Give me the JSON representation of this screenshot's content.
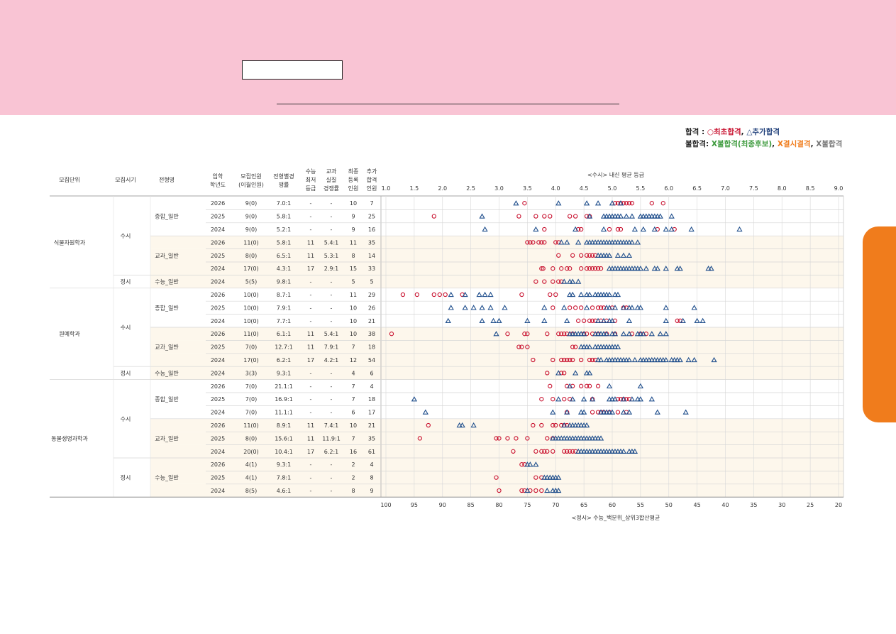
{
  "legend": {
    "pass_label": "합격",
    "pass_sep": " : ",
    "first_pass": "○최초합격",
    "comma": ", ",
    "add_pass": "△추가합격",
    "fail_label": "불합격",
    "fail_sep": ": ",
    "fail_waitlist": "X불합격(최종후보)",
    "fail_absent": "X결시결격",
    "fail_plain": "X불합격"
  },
  "colors": {
    "first": "#c8102e",
    "additional": "#1f4e8c",
    "grid": "#dddddd",
    "band": "#fdf7ec"
  },
  "headers": {
    "unit": "모집단위",
    "period": "모집시기",
    "type": "전형명",
    "year": [
      "입학",
      "학년도"
    ],
    "quota": [
      "모집인원",
      "(이월인원)"
    ],
    "ratio": [
      "전형별경",
      "쟁률"
    ],
    "min": [
      "수능",
      "최저",
      "등급"
    ],
    "actual": [
      "교과",
      "실질",
      "경쟁률"
    ],
    "reg": [
      "최종",
      "등록",
      "인원"
    ],
    "extra": [
      "추가",
      "합격",
      "인원"
    ]
  },
  "chart_data": {
    "type": "scatter",
    "title": "<수시> 내신 평균 등급",
    "xlabel": "<정시> 수능_백분위_상위3합산평균",
    "x_top_ticks": [
      "1.0",
      "1.5",
      "2.0",
      "2.5",
      "3.0",
      "3.5",
      "4.0",
      "4.5",
      "5.0",
      "5.5",
      "6.0",
      "6.5",
      "7.0",
      "7.5",
      "8.0",
      "8.5",
      "9.0"
    ],
    "x_top_range": [
      1.0,
      9.0
    ],
    "x_bottom_ticks": [
      "100",
      "95",
      "90",
      "85",
      "80",
      "75",
      "70",
      "65",
      "60",
      "55",
      "50",
      "45",
      "40",
      "35",
      "30",
      "25",
      "20"
    ],
    "x_bottom_range": [
      100,
      20
    ],
    "legend": [
      "○ 최초합격",
      "△ 추가합격"
    ],
    "grid": true
  },
  "groups": [
    {
      "unit": "식물자원학과",
      "rows": [
        {
          "period": "수시",
          "type": "종합_일반",
          "year": "2026",
          "quota": "9(0)",
          "ratio": "7.0:1",
          "min": "-",
          "actual": "-",
          "reg": "10",
          "extra": "7",
          "first": [
            3.45,
            5.05,
            5.1,
            5.15,
            5.2,
            5.25,
            5.3,
            5.35,
            5.7,
            5.9
          ],
          "additional": [
            3.3,
            4.05,
            4.55,
            4.75,
            5.0,
            5.15
          ]
        },
        {
          "period": "수시",
          "type": "종합_일반",
          "year": "2025",
          "quota": "9(0)",
          "ratio": "5.8:1",
          "min": "-",
          "actual": "-",
          "reg": "9",
          "extra": "25",
          "first": [
            1.85,
            3.35,
            3.65,
            3.8,
            3.9,
            4.25,
            4.35,
            4.55,
            4.6
          ],
          "additional": [
            2.7,
            4.6,
            4.85,
            4.9,
            4.95,
            5.0,
            5.05,
            5.1,
            5.15,
            5.25,
            5.35,
            5.5,
            5.55,
            5.6,
            5.65,
            5.7,
            5.75,
            5.8,
            5.85,
            6.05
          ]
        },
        {
          "period": "수시",
          "type": "종합_일반",
          "year": "2024",
          "quota": "9(0)",
          "ratio": "5.2:1",
          "min": "-",
          "actual": "-",
          "reg": "9",
          "extra": "16",
          "first": [
            3.8,
            4.4,
            4.45,
            4.95,
            5.1,
            5.15,
            5.8,
            6.1
          ],
          "additional": [
            2.75,
            3.65,
            4.35,
            4.85,
            5.4,
            5.55,
            5.75,
            5.95,
            6.05,
            6.4,
            7.25
          ]
        },
        {
          "period": "수시",
          "type": "교과_일반",
          "year": "2026",
          "quota": "11(0)",
          "ratio": "5.8:1",
          "min": "11",
          "actual": "5.4:1",
          "reg": "11",
          "expanded": "35",
          "extra": "35",
          "first": [
            3.5,
            3.55,
            3.6,
            3.7,
            3.75,
            3.8,
            4.0,
            4.05
          ],
          "additional": [
            4.1,
            4.2,
            4.4,
            4.55,
            4.6,
            4.65,
            4.7,
            4.75,
            4.8,
            4.85,
            4.9,
            4.95,
            5.0,
            5.05,
            5.1,
            5.15,
            5.2,
            5.25,
            5.3,
            5.35,
            5.45
          ]
        },
        {
          "period": "수시",
          "type": "교과_일반",
          "year": "2025",
          "quota": "8(0)",
          "ratio": "6.5:1",
          "min": "11",
          "actual": "5.3:1",
          "reg": "8",
          "extra": "14",
          "first": [
            4.05,
            4.3,
            4.45,
            4.55,
            4.6,
            4.65,
            4.7
          ],
          "additional": [
            4.75,
            4.8,
            4.85,
            4.9,
            4.95,
            5.1,
            5.2,
            5.3
          ]
        },
        {
          "period": "수시",
          "type": "교과_일반",
          "year": "2024",
          "quota": "17(0)",
          "ratio": "4.3:1",
          "min": "17",
          "actual": "2.9:1",
          "reg": "15",
          "extra": "33",
          "first": [
            3.75,
            3.78,
            3.95,
            4.1,
            4.2,
            4.25,
            4.45,
            4.55,
            4.6,
            4.65,
            4.7,
            4.75,
            4.8
          ],
          "additional": [
            4.95,
            5.0,
            5.05,
            5.1,
            5.15,
            5.2,
            5.25,
            5.3,
            5.35,
            5.4,
            5.45,
            5.5,
            5.6,
            5.75,
            5.8,
            5.95,
            6.15,
            6.2,
            6.7,
            6.75
          ]
        },
        {
          "period": "정시",
          "type": "수능_일반",
          "year": "2024",
          "quota": "5(5)",
          "ratio": "9.8:1",
          "min": "-",
          "actual": "-",
          "reg": "5",
          "extra": "5",
          "first": [
            3.65,
            3.8,
            3.95,
            4.05,
            4.1
          ],
          "additional": [
            4.15,
            4.25,
            4.3,
            4.4
          ]
        }
      ]
    },
    {
      "unit": "원예학과",
      "rows": [
        {
          "period": "수시",
          "type": "종합_일반",
          "year": "2026",
          "quota": "10(0)",
          "ratio": "8.7:1",
          "min": "-",
          "actual": "-",
          "reg": "11",
          "extra": "29",
          "first": [
            1.3,
            1.55,
            1.85,
            1.95,
            2.05,
            2.35,
            3.4,
            3.9,
            4.0
          ],
          "additional": [
            2.15,
            2.4,
            2.65,
            2.75,
            2.85,
            4.25,
            4.3,
            4.45,
            4.55,
            4.6,
            4.7,
            4.75,
            4.8,
            4.85,
            4.9,
            4.95,
            5.05,
            5.1
          ]
        },
        {
          "period": "수시",
          "type": "종합_일반",
          "year": "2025",
          "quota": "10(0)",
          "ratio": "7.9:1",
          "min": "-",
          "actual": "-",
          "reg": "10",
          "extra": "26",
          "first": [
            3.95,
            4.25,
            4.35,
            4.45,
            4.65,
            4.75,
            4.8,
            4.85,
            5.0,
            5.2,
            5.25
          ],
          "additional": [
            2.15,
            2.4,
            2.55,
            2.7,
            2.85,
            3.1,
            3.8,
            4.15,
            4.55,
            4.9,
            4.95,
            5.05,
            5.2,
            5.3,
            5.35,
            5.45,
            5.5,
            5.95,
            6.45
          ]
        },
        {
          "period": "수시",
          "type": "종합_일반",
          "year": "2024",
          "quota": "10(0)",
          "ratio": "7.7:1",
          "min": "-",
          "actual": "-",
          "reg": "10",
          "extra": "21",
          "first": [
            4.4,
            4.5,
            4.6,
            4.65,
            4.7,
            4.8,
            4.9,
            5.05,
            6.15,
            6.2
          ],
          "additional": [
            2.1,
            2.7,
            2.9,
            3.0,
            3.5,
            3.8,
            4.2,
            4.75,
            4.85,
            4.95,
            5.0,
            5.3,
            5.95,
            6.25,
            6.5,
            6.6
          ]
        },
        {
          "period": "수시",
          "type": "교과_일반",
          "year": "2026",
          "quota": "11(0)",
          "ratio": "6.1:1",
          "min": "11",
          "actual": "5.4:1",
          "reg": "10",
          "extra": "38",
          "first": [
            1.1,
            3.15,
            3.45,
            3.5,
            3.85,
            4.05,
            4.1,
            4.15,
            4.2,
            4.3,
            4.5,
            4.55,
            4.65,
            4.75,
            4.9,
            5.05,
            5.35,
            5.5,
            5.6
          ],
          "additional": [
            2.95,
            4.25,
            4.3,
            4.35,
            4.4,
            4.45,
            4.5,
            4.7,
            4.75,
            4.8,
            4.85,
            4.9,
            5.0,
            5.05,
            5.2,
            5.3,
            5.45,
            5.5,
            5.55,
            5.7,
            5.85,
            5.95
          ]
        },
        {
          "period": "수시",
          "type": "교과_일반",
          "year": "2025",
          "quota": "7(0)",
          "ratio": "12.7:1",
          "min": "11",
          "actual": "7.9:1",
          "reg": "7",
          "extra": "18",
          "first": [
            3.35,
            3.4,
            3.5,
            4.3,
            4.35
          ],
          "additional": [
            4.45,
            4.5,
            4.55,
            4.6,
            4.7,
            4.75,
            4.8,
            4.85,
            4.9,
            4.95,
            5.0,
            5.05,
            5.1
          ]
        },
        {
          "period": "수시",
          "type": "교과_일반",
          "year": "2024",
          "quota": "17(0)",
          "ratio": "6.2:1",
          "min": "17",
          "actual": "4.2:1",
          "reg": "12",
          "extra": "54",
          "first": [
            3.6,
            3.95,
            4.1,
            4.15,
            4.2,
            4.25,
            4.3,
            4.45,
            4.6,
            4.65,
            4.7
          ],
          "additional": [
            4.75,
            4.8,
            4.9,
            4.95,
            5.0,
            5.05,
            5.1,
            5.15,
            5.2,
            5.25,
            5.3,
            5.4,
            5.5,
            5.55,
            5.6,
            5.65,
            5.7,
            5.75,
            5.8,
            5.85,
            5.9,
            5.95,
            6.05,
            6.1,
            6.15,
            6.2,
            6.35,
            6.45,
            6.8
          ]
        },
        {
          "period": "정시",
          "type": "수능_일반",
          "year": "2024",
          "quota": "3(3)",
          "ratio": "9.3:1",
          "min": "-",
          "actual": "-",
          "reg": "4",
          "extra": "6",
          "first": [
            3.85,
            4.1,
            4.15
          ],
          "additional": [
            4.05,
            4.35,
            4.55,
            4.6
          ]
        }
      ]
    },
    {
      "unit": "동물생명과학과",
      "rows": [
        {
          "period": "수시",
          "type": "종합_일반",
          "year": "2026",
          "quota": "7(0)",
          "ratio": "21.1:1",
          "min": "-",
          "actual": "-",
          "reg": "7",
          "extra": "4",
          "first": [
            3.9,
            4.2,
            4.3,
            4.45,
            4.55,
            4.6,
            4.75
          ],
          "additional": [
            4.25,
            4.95,
            5.5
          ]
        },
        {
          "period": "수시",
          "type": "종합_일반",
          "year": "2025",
          "quota": "7(0)",
          "ratio": "16.9:1",
          "min": "-",
          "actual": "-",
          "reg": "7",
          "extra": "18",
          "first": [
            3.75,
            3.95,
            4.15,
            4.25,
            4.65,
            5.1,
            5.15,
            5.2,
            5.25,
            5.3
          ],
          "additional": [
            1.5,
            4.05,
            4.3,
            4.5,
            4.65,
            4.95,
            5.0,
            5.05,
            5.2,
            5.35,
            5.45,
            5.5,
            5.7
          ]
        },
        {
          "period": "수시",
          "type": "종합_일반",
          "year": "2024",
          "quota": "7(0)",
          "ratio": "11.1:1",
          "min": "-",
          "actual": "-",
          "reg": "6",
          "extra": "17",
          "first": [
            4.2,
            4.65,
            4.75,
            4.8,
            4.85,
            4.95,
            5.1,
            5.25
          ],
          "additional": [
            1.7,
            3.95,
            4.2,
            4.45,
            4.5,
            4.8,
            4.85,
            4.9,
            4.95,
            5.0,
            5.2,
            5.3,
            5.8,
            6.3
          ]
        },
        {
          "period": "수시",
          "type": "교과_일반",
          "year": "2026",
          "quota": "11(0)",
          "ratio": "8.9:1",
          "min": "11",
          "actual": "7.4:1",
          "reg": "10",
          "extra": "21",
          "first": [
            1.75,
            3.6,
            3.75,
            3.95,
            4.0,
            4.1,
            4.15,
            4.2
          ],
          "additional": [
            2.3,
            2.35,
            2.55,
            4.15,
            4.25,
            4.3,
            4.35,
            4.4,
            4.45,
            4.5,
            4.55
          ]
        },
        {
          "period": "수시",
          "type": "교과_일반",
          "year": "2025",
          "quota": "8(0)",
          "ratio": "15.6:1",
          "min": "11",
          "actual": "11.9:1",
          "reg": "7",
          "extra": "35",
          "first": [
            1.6,
            2.95,
            3.0,
            3.15,
            3.3,
            3.5,
            3.85,
            3.95
          ],
          "additional": [
            3.95,
            4.0,
            4.05,
            4.1,
            4.15,
            4.2,
            4.25,
            4.3,
            4.35,
            4.4,
            4.45,
            4.5,
            4.55,
            4.6,
            4.65,
            4.7,
            4.75,
            4.8
          ]
        },
        {
          "period": "수시",
          "type": "교과_일반",
          "year": "2024",
          "quota": "20(0)",
          "ratio": "10.4:1",
          "min": "17",
          "actual": "6.2:1",
          "reg": "16",
          "extra": "61",
          "first": [
            3.25,
            3.65,
            3.75,
            3.8,
            3.85,
            3.95,
            4.15,
            4.2,
            4.25,
            4.3,
            4.35
          ],
          "additional": [
            4.4,
            4.45,
            4.5,
            4.55,
            4.6,
            4.65,
            4.7,
            4.75,
            4.8,
            4.85,
            4.9,
            4.95,
            5.0,
            5.05,
            5.1,
            5.15,
            5.2,
            5.3,
            5.35,
            5.4
          ]
        },
        {
          "period": "정시",
          "type": "수능_일반",
          "year": "2026",
          "quota": "4(1)",
          "ratio": "9.3:1",
          "min": "-",
          "actual": "-",
          "reg": "2",
          "extra": "4",
          "first": [
            3.4,
            3.45
          ],
          "additional": [
            3.5,
            3.55,
            3.65
          ]
        },
        {
          "period": "정시",
          "type": "수능_일반",
          "year": "2025",
          "quota": "4(1)",
          "ratio": "7.8:1",
          "min": "-",
          "actual": "-",
          "reg": "2",
          "extra": "8",
          "first": [
            2.95,
            3.65,
            3.75
          ],
          "additional": [
            3.8,
            3.85,
            3.9,
            3.95,
            4.0,
            4.05
          ]
        },
        {
          "period": "정시",
          "type": "수능_일반",
          "year": "2024",
          "quota": "8(5)",
          "ratio": "4.6:1",
          "min": "-",
          "actual": "-",
          "reg": "8",
          "extra": "9",
          "first": [
            3.0,
            3.4,
            3.45,
            3.55,
            3.65,
            3.75
          ],
          "additional": [
            3.5,
            3.85,
            3.95,
            4.0,
            4.05
          ]
        }
      ]
    }
  ]
}
